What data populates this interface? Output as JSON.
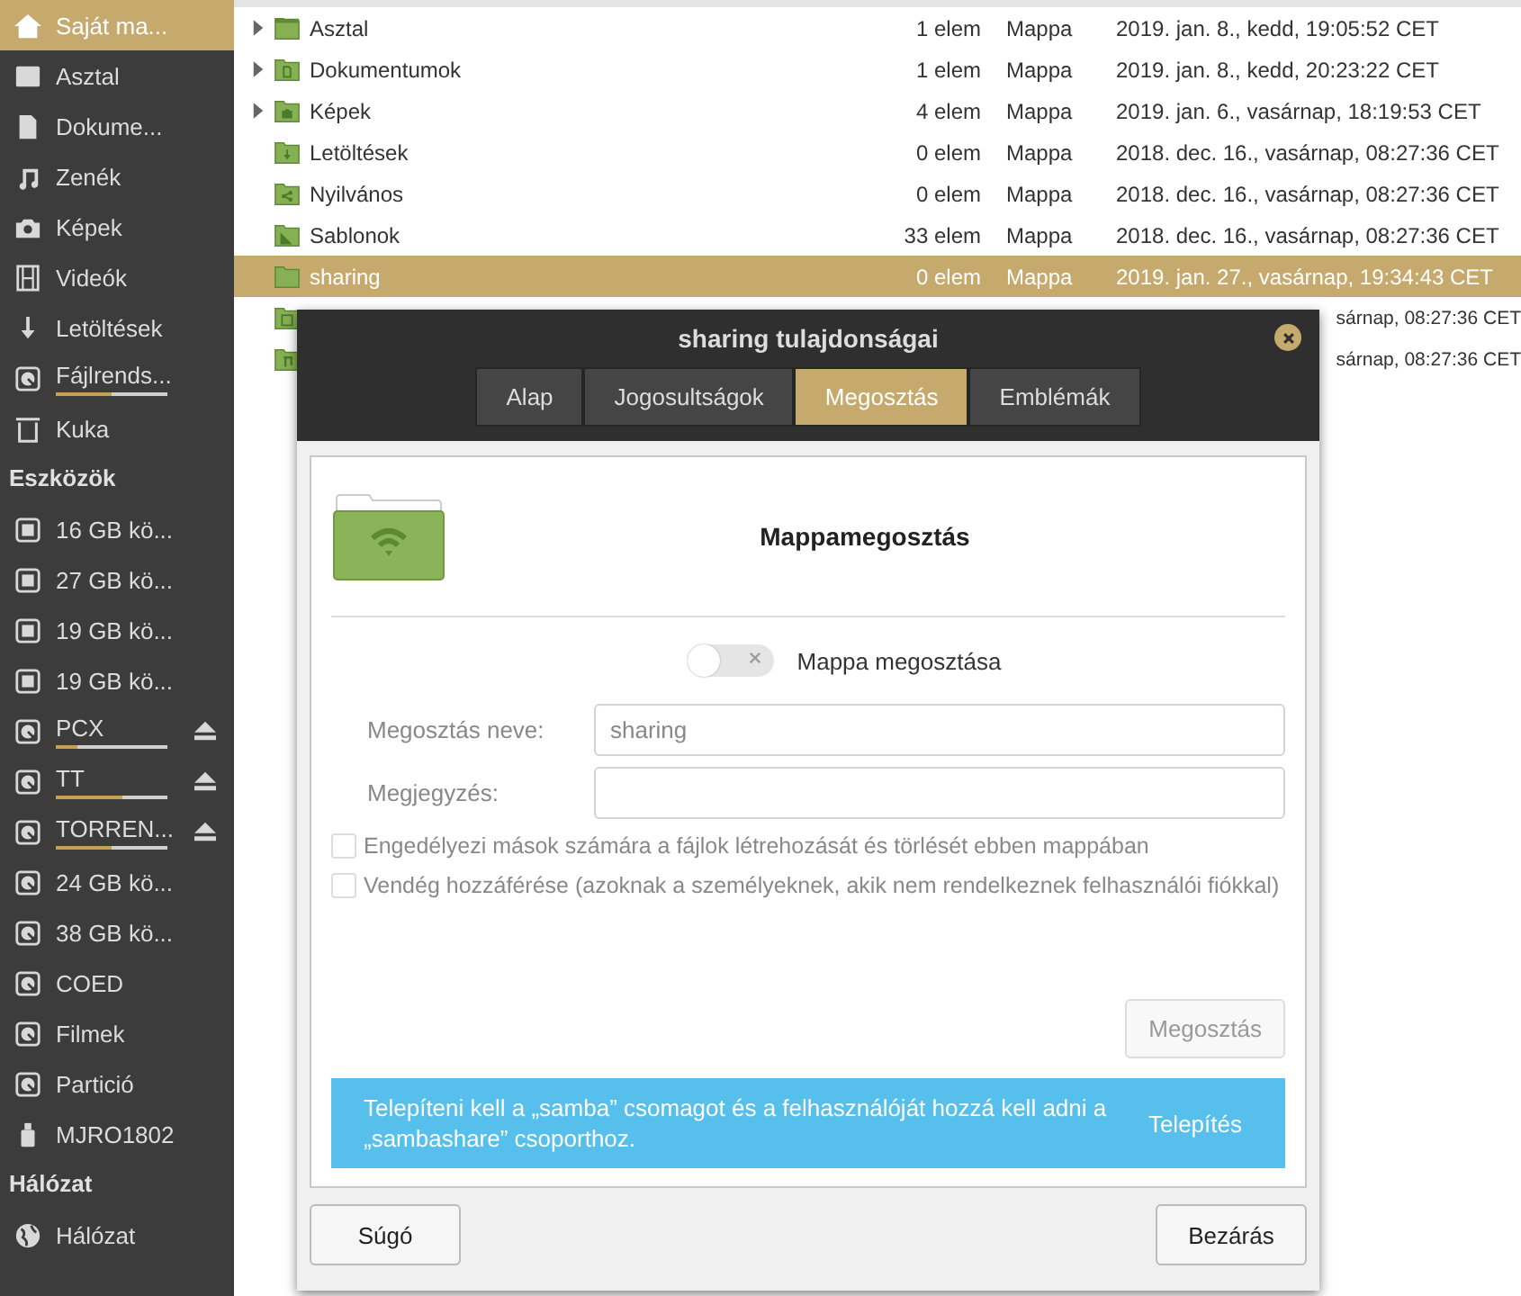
{
  "sidebar": {
    "items": [
      {
        "kind": "home",
        "label": "Saját ma...",
        "selected": true
      },
      {
        "kind": "desktop",
        "label": "Asztal",
        "selected": false
      },
      {
        "kind": "document",
        "label": "Dokume...",
        "selected": false
      },
      {
        "kind": "music",
        "label": "Zenék",
        "selected": false
      },
      {
        "kind": "camera",
        "label": "Képek",
        "selected": false
      },
      {
        "kind": "film",
        "label": "Videók",
        "selected": false
      },
      {
        "kind": "download",
        "label": "Letöltések",
        "selected": false
      },
      {
        "kind": "disk",
        "label": "Fájlrends...",
        "selected": false,
        "level": 0.5
      },
      {
        "kind": "trash",
        "label": "Kuka",
        "selected": false
      },
      {
        "kind": "header",
        "label": "Eszközök"
      },
      {
        "kind": "chip",
        "label": "16 GB kö...",
        "selected": false
      },
      {
        "kind": "chip",
        "label": "27 GB kö...",
        "selected": false
      },
      {
        "kind": "chip",
        "label": "19 GB kö...",
        "selected": false
      },
      {
        "kind": "chip",
        "label": "19 GB kö...",
        "selected": false
      },
      {
        "kind": "disk",
        "label": "PCX",
        "selected": false,
        "level": 0.2,
        "eject": true
      },
      {
        "kind": "disk",
        "label": "TT",
        "selected": false,
        "level": 0.6,
        "eject": true
      },
      {
        "kind": "disk",
        "label": "TORREN...",
        "selected": false,
        "level": 0.5,
        "eject": true
      },
      {
        "kind": "disk",
        "label": "24 GB kö...",
        "selected": false
      },
      {
        "kind": "disk",
        "label": "38 GB kö...",
        "selected": false
      },
      {
        "kind": "disk",
        "label": "COED",
        "selected": false
      },
      {
        "kind": "disk",
        "label": "Filmek",
        "selected": false
      },
      {
        "kind": "disk",
        "label": "Partició",
        "selected": false
      },
      {
        "kind": "usb",
        "label": "MJRO1802",
        "selected": false
      },
      {
        "kind": "header",
        "label": "Hálózat"
      },
      {
        "kind": "globe",
        "label": "Hálózat",
        "selected": false
      }
    ]
  },
  "files": {
    "rows": [
      {
        "kind": "desktop",
        "expandable": true,
        "name": "Asztal",
        "count": "1 elem",
        "type": "Mappa",
        "date": "2019. jan. 8., kedd, 19:05:52 CET",
        "selected": false
      },
      {
        "kind": "document",
        "expandable": true,
        "name": "Dokumentumok",
        "count": "1 elem",
        "type": "Mappa",
        "date": "2019. jan. 8., kedd, 20:23:22 CET",
        "selected": false
      },
      {
        "kind": "camera",
        "expandable": true,
        "name": "Képek",
        "count": "4 elem",
        "type": "Mappa",
        "date": "2019. jan. 6., vasárnap, 18:19:53 CET",
        "selected": false
      },
      {
        "kind": "download",
        "expandable": false,
        "name": "Letöltések",
        "count": "0 elem",
        "type": "Mappa",
        "date": "2018. dec. 16., vasárnap, 08:27:36 CET",
        "selected": false
      },
      {
        "kind": "share",
        "expandable": false,
        "name": "Nyilvános",
        "count": "0 elem",
        "type": "Mappa",
        "date": "2018. dec. 16., vasárnap, 08:27:36 CET",
        "selected": false
      },
      {
        "kind": "template",
        "expandable": false,
        "name": "Sablonok",
        "count": "33 elem",
        "type": "Mappa",
        "date": "2018. dec. 16., vasárnap, 08:27:36 CET",
        "selected": false
      },
      {
        "kind": "plain",
        "expandable": false,
        "name": "sharing",
        "count": "0 elem",
        "type": "Mappa",
        "date": "2019. jan. 27., vasárnap, 19:34:43 CET",
        "selected": true
      },
      {
        "kind": "film",
        "expandable": false,
        "date": "sárnap, 08:27:36 CET",
        "selected": false
      },
      {
        "kind": "music",
        "expandable": false,
        "date": "sárnap, 08:27:36 CET",
        "selected": false
      }
    ]
  },
  "dialog": {
    "title": "sharing tulajdonságai",
    "tabs": [
      {
        "label": "Alap",
        "selected": false
      },
      {
        "label": "Jogosultságok",
        "selected": false
      },
      {
        "label": "Megosztás",
        "selected": true
      },
      {
        "label": "Emblémák",
        "selected": false
      }
    ],
    "heading": "Mappamegosztás",
    "toggle": {
      "label": "Mappa megosztása",
      "on": false
    },
    "fields": [
      {
        "label": "Megosztás neve:",
        "value": "sharing",
        "disabled": true
      },
      {
        "label": "Megjegyzés:",
        "disabled": true
      }
    ],
    "checkboxes": [
      {
        "label": "Engedélyezi mások számára a fájlok létrehozását és törlését ebben mappában",
        "checked": false,
        "disabled": true
      },
      {
        "label": "Vendég hozzáférése (azoknak a személyeknek, akik nem rendelkeznek felhasználói fiókkal)",
        "checked": false,
        "disabled": true
      }
    ],
    "share_button": {
      "label": "Megosztás",
      "disabled": true
    },
    "info_bar": {
      "message": "Telepíteni kell a „samba” csomagot és a felhasználóját hozzá kell adni a „sambashare” csoporthoz.",
      "action": "Telepítés"
    },
    "buttons": [
      {
        "label": "Súgó"
      },
      {
        "label": "Bezárás"
      }
    ]
  }
}
